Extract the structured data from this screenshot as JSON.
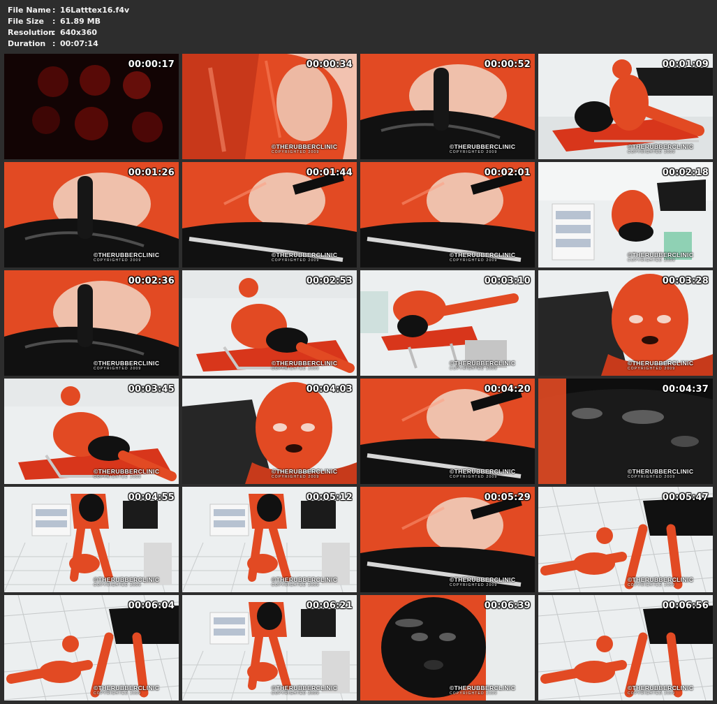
{
  "file_info": {
    "rows": [
      {
        "label": "File Name",
        "sep": ":",
        "value": "16Latttex16.f4v"
      },
      {
        "label": "File Size",
        "sep": ":",
        "value": "61.89 MB"
      },
      {
        "label": "Resolution",
        "sep": ":",
        "value": "640x360"
      },
      {
        "label": "Duration",
        "sep": ":",
        "value": "00:07:14"
      }
    ]
  },
  "watermark": {
    "brand": "©THERUBBERCLINIC",
    "copyright": "COPYRIGHTED 2009"
  },
  "colors": {
    "background": "#2d2d2d",
    "latex_red": "#e24a23",
    "latex_black": "#111111",
    "clinic_white": "#eceff0",
    "text": "#ffffff"
  },
  "thumbnails": [
    {
      "timestamp": "00:00:17",
      "scene": "dark-red-haze"
    },
    {
      "timestamp": "00:00:34",
      "scene": "red-latex-closeup"
    },
    {
      "timestamp": "00:00:52",
      "scene": "red-over-black-closeup"
    },
    {
      "timestamp": "00:01:09",
      "scene": "figures-on-exam-chair"
    },
    {
      "timestamp": "00:01:26",
      "scene": "red-over-black-closeup"
    },
    {
      "timestamp": "00:01:44",
      "scene": "red-over-black-with-rail"
    },
    {
      "timestamp": "00:02:01",
      "scene": "red-over-black-with-rail"
    },
    {
      "timestamp": "00:02:18",
      "scene": "clinic-room-wide"
    },
    {
      "timestamp": "00:02:36",
      "scene": "red-over-black-closeup"
    },
    {
      "timestamp": "00:02:53",
      "scene": "figure-on-exam-chair"
    },
    {
      "timestamp": "00:03:10",
      "scene": "figure-on-exam-chair-wide"
    },
    {
      "timestamp": "00:03:28",
      "scene": "red-hood-portrait"
    },
    {
      "timestamp": "00:03:45",
      "scene": "figure-on-exam-chair"
    },
    {
      "timestamp": "00:04:03",
      "scene": "red-hood-portrait"
    },
    {
      "timestamp": "00:04:20",
      "scene": "red-over-black-with-rail"
    },
    {
      "timestamp": "00:04:37",
      "scene": "black-latex-closeup"
    },
    {
      "timestamp": "00:04:55",
      "scene": "clinic-floor-wide"
    },
    {
      "timestamp": "00:05:12",
      "scene": "clinic-floor-wide"
    },
    {
      "timestamp": "00:05:29",
      "scene": "red-over-black-with-rail"
    },
    {
      "timestamp": "00:05:47",
      "scene": "floor-tiles-figures"
    },
    {
      "timestamp": "00:06:04",
      "scene": "floor-tiles-figures"
    },
    {
      "timestamp": "00:06:21",
      "scene": "clinic-floor-wide"
    },
    {
      "timestamp": "00:06:39",
      "scene": "black-hood-portrait"
    },
    {
      "timestamp": "00:06:56",
      "scene": "floor-tiles-figures"
    }
  ]
}
